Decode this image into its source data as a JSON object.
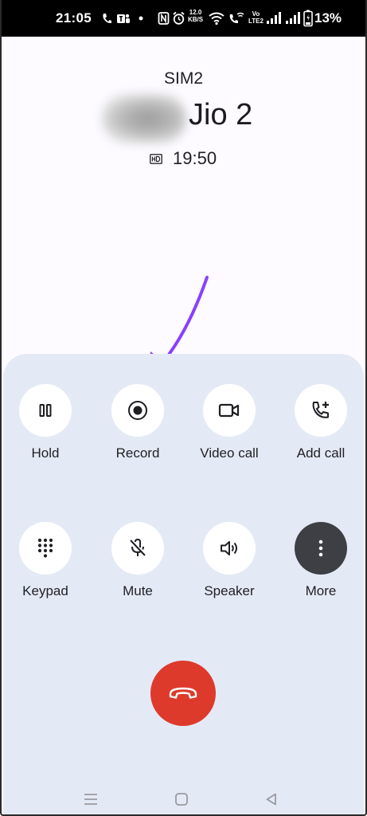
{
  "status_bar": {
    "time": "21:05",
    "speed_value": "12.0",
    "speed_unit": "KB/S",
    "volte_top": "Vo",
    "volte_bottom": "LTE2",
    "battery": "13%"
  },
  "call": {
    "sim": "SIM2",
    "name": "Jio 2",
    "duration": "19:50"
  },
  "controls": {
    "hold": "Hold",
    "record": "Record",
    "video_call": "Video call",
    "add_call": "Add call",
    "keypad": "Keypad",
    "mute": "Mute",
    "speaker": "Speaker",
    "more": "More"
  },
  "colors": {
    "panel": "#e4eaf5",
    "end_call": "#dd3a2c",
    "arrow": "#8a3ffc",
    "more_button": "#3e3f44"
  }
}
